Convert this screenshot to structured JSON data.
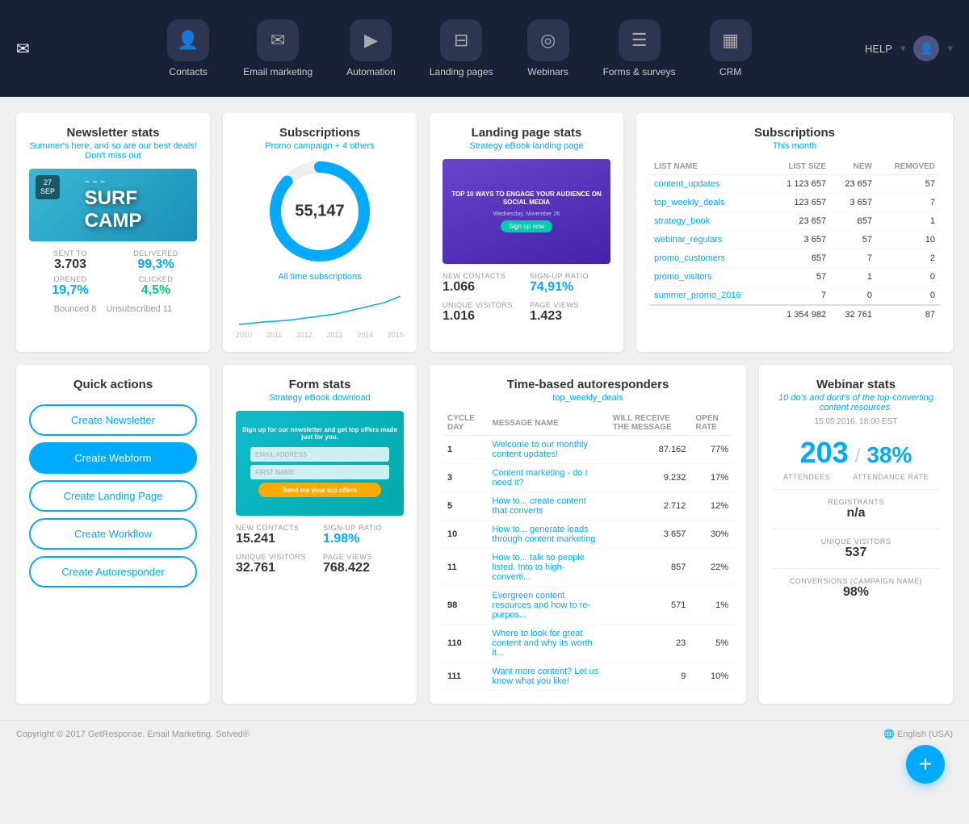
{
  "nav": {
    "logo": "✉",
    "help": "HELP",
    "items": [
      {
        "id": "contacts",
        "label": "Contacts",
        "icon": "👤"
      },
      {
        "id": "email-marketing",
        "label": "Email marketing",
        "icon": "✉"
      },
      {
        "id": "automation",
        "label": "Automation",
        "icon": "▶"
      },
      {
        "id": "landing-pages",
        "label": "Landing pages",
        "icon": "⊟"
      },
      {
        "id": "webinars",
        "label": "Webinars",
        "icon": "◎"
      },
      {
        "id": "forms-surveys",
        "label": "Forms & surveys",
        "icon": "≡"
      },
      {
        "id": "crm",
        "label": "CRM",
        "icon": "▦"
      }
    ]
  },
  "newsletter": {
    "title": "Newsletter stats",
    "subtitle": "Summer's here, and so are our best deals! Don't miss out",
    "date": "27",
    "month": "SEP",
    "surf_text": "SURF CAMP",
    "sent_to_label": "SENT TO",
    "sent_to": "3.703",
    "delivered_label": "DELIVERED",
    "delivered": "99,3%",
    "opened_label": "OPENED",
    "opened": "19,7%",
    "clicked_label": "CLICKED",
    "clicked": "4,5%",
    "bounced": "Bounced",
    "bounced_val": "8",
    "unsubscribed": "Unsubscribed",
    "unsubscribed_val": "11"
  },
  "subscriptions_donut": {
    "title": "Subscriptions",
    "subtitle": "Promo campaign + 4 others",
    "value": "55,147",
    "all_time": "All time subscriptions"
  },
  "landing_stats": {
    "title": "Landing page stats",
    "subtitle": "Strategy eBook landing page",
    "preview_text": "TOP 10 WAYS TO ENGAGE YOUR AUDIENCE ON SOCIAL MEDIA",
    "new_contacts_label": "NEW CONTACTS",
    "new_contacts": "1.066",
    "signup_ratio_label": "SIGN-UP RATIO",
    "signup_ratio": "74,91%",
    "unique_visitors_label": "UNIQUE VISITORS",
    "unique_visitors": "1.016",
    "page_views_label": "PAGE VIEWS",
    "page_views": "1.423"
  },
  "subscriptions_table": {
    "title": "Subscriptions",
    "subtitle": "This month",
    "col_list": "LIST NAME",
    "col_size": "LIST SIZE",
    "col_new": "NEW",
    "col_removed": "REMOVED",
    "rows": [
      {
        "name": "content_updates",
        "size": "1 123 657",
        "new": "23 657",
        "removed": "57"
      },
      {
        "name": "top_weekly_deals",
        "size": "123 657",
        "new": "3 657",
        "removed": "7"
      },
      {
        "name": "strategy_book",
        "size": "23 657",
        "new": "657",
        "removed": "1"
      },
      {
        "name": "webinar_regulars",
        "size": "3 657",
        "new": "57",
        "removed": "10"
      },
      {
        "name": "promo_customers",
        "size": "657",
        "new": "7",
        "removed": "2"
      },
      {
        "name": "promo_visitors",
        "size": "57",
        "new": "1",
        "removed": "0"
      },
      {
        "name": "summer_promo_2016",
        "size": "7",
        "new": "0",
        "removed": "0"
      }
    ],
    "total_size": "1 354 982",
    "total_new": "32 761",
    "total_removed": "87"
  },
  "quick_actions": {
    "title": "Quick actions",
    "buttons": [
      {
        "id": "create-newsletter",
        "label": "Create Newsletter",
        "filled": false
      },
      {
        "id": "create-webform",
        "label": "Create Webform",
        "filled": true
      },
      {
        "id": "create-landing-page",
        "label": "Create Landing Page",
        "filled": false
      },
      {
        "id": "create-workflow",
        "label": "Create Workflow",
        "filled": false
      },
      {
        "id": "create-autoresponder",
        "label": "Create Autoresponder",
        "filled": false
      }
    ]
  },
  "form_stats": {
    "title": "Form stats",
    "subtitle": "Strategy eBook download",
    "form_text": "Sign up for our newsletter and get top offers made just for you.",
    "btn_text": "Send me your top offers",
    "new_contacts_label": "NEW CONTACTS",
    "new_contacts": "15.241",
    "signup_ratio_label": "SIGN-UP RATIO",
    "signup_ratio": "1.98%",
    "unique_visitors_label": "UNIQUE VISITORS",
    "unique_visitors": "32.761",
    "page_views_label": "PAGE VIEWS",
    "page_views": "768.422"
  },
  "autoresponders": {
    "title": "Time-based autoresponders",
    "subtitle": "top_weekly_deals",
    "col_cycle": "CYCLE DAY",
    "col_message": "MESSAGE NAME",
    "col_will_receive": "WILL RECEIVE THE MESSAGE",
    "col_open_rate": "OPEN RATE",
    "rows": [
      {
        "cycle": "1",
        "name": "Welcome to our monthly content updates!",
        "will_receive": "87.162",
        "open_rate": "77%"
      },
      {
        "cycle": "3",
        "name": "Content marketing - do I need it?",
        "will_receive": "9.232",
        "open_rate": "17%"
      },
      {
        "cycle": "5",
        "name": "How to... create content that converts",
        "will_receive": "2.712",
        "open_rate": "12%"
      },
      {
        "cycle": "10",
        "name": "How to... generate leads through content marketing",
        "will_receive": "3 657",
        "open_rate": "30%"
      },
      {
        "cycle": "11",
        "name": "How to... talk so people listed. Into to high-converti...",
        "will_receive": "857",
        "open_rate": "22%"
      },
      {
        "cycle": "98",
        "name": "Evergreen content resources and how to re-purpos...",
        "will_receive": "571",
        "open_rate": "1%"
      },
      {
        "cycle": "110",
        "name": "Where to look for great content and why its worth it...",
        "will_receive": "23",
        "open_rate": "5%"
      },
      {
        "cycle": "111",
        "name": "Want more content? Let us know what you like!",
        "will_receive": "9",
        "open_rate": "10%"
      }
    ]
  },
  "webinar": {
    "title": "Webinar stats",
    "subtitle": "10 do's and dont's of the top-converting content resources.",
    "date": "15.05.2016, 18:00 EST",
    "attendees": "203",
    "attendees_label": "ATTENDEES",
    "attendance_rate": "38%",
    "attendance_rate_label": "ATTENDANCE RATE",
    "registrants_label": "REGISTRANTS",
    "registrants": "n/a",
    "unique_visitors_label": "UNIQUE VISITORS",
    "unique_visitors": "537",
    "conversions_label": "CONVERSIONS (CAMPAIGN NAME)",
    "conversions": "98%"
  },
  "footer": {
    "copyright": "Copyright © 2017 GetResponse. Email Marketing. Solved®",
    "language": "English (USA)"
  }
}
